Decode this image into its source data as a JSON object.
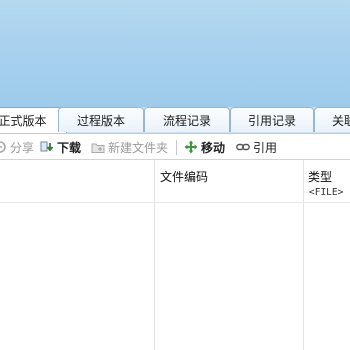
{
  "tabs": [
    {
      "label": "正式版本"
    },
    {
      "label": "过程版本"
    },
    {
      "label": "流程记录"
    },
    {
      "label": "引用记录"
    },
    {
      "label": "关联"
    }
  ],
  "toolbar": {
    "share": "分享",
    "download": "下载",
    "new_folder": "新建文件夹",
    "move": "移动",
    "reference": "引用"
  },
  "grid": {
    "columns": [
      {
        "label": "文件编码"
      },
      {
        "label": "类型",
        "sub": "<FILE>"
      }
    ]
  },
  "colors": {
    "banner": "#a6d0ee",
    "tab_border": "#98b6cf",
    "move_icon": "#3a9a3a",
    "download_icon": "#2e7d32"
  }
}
